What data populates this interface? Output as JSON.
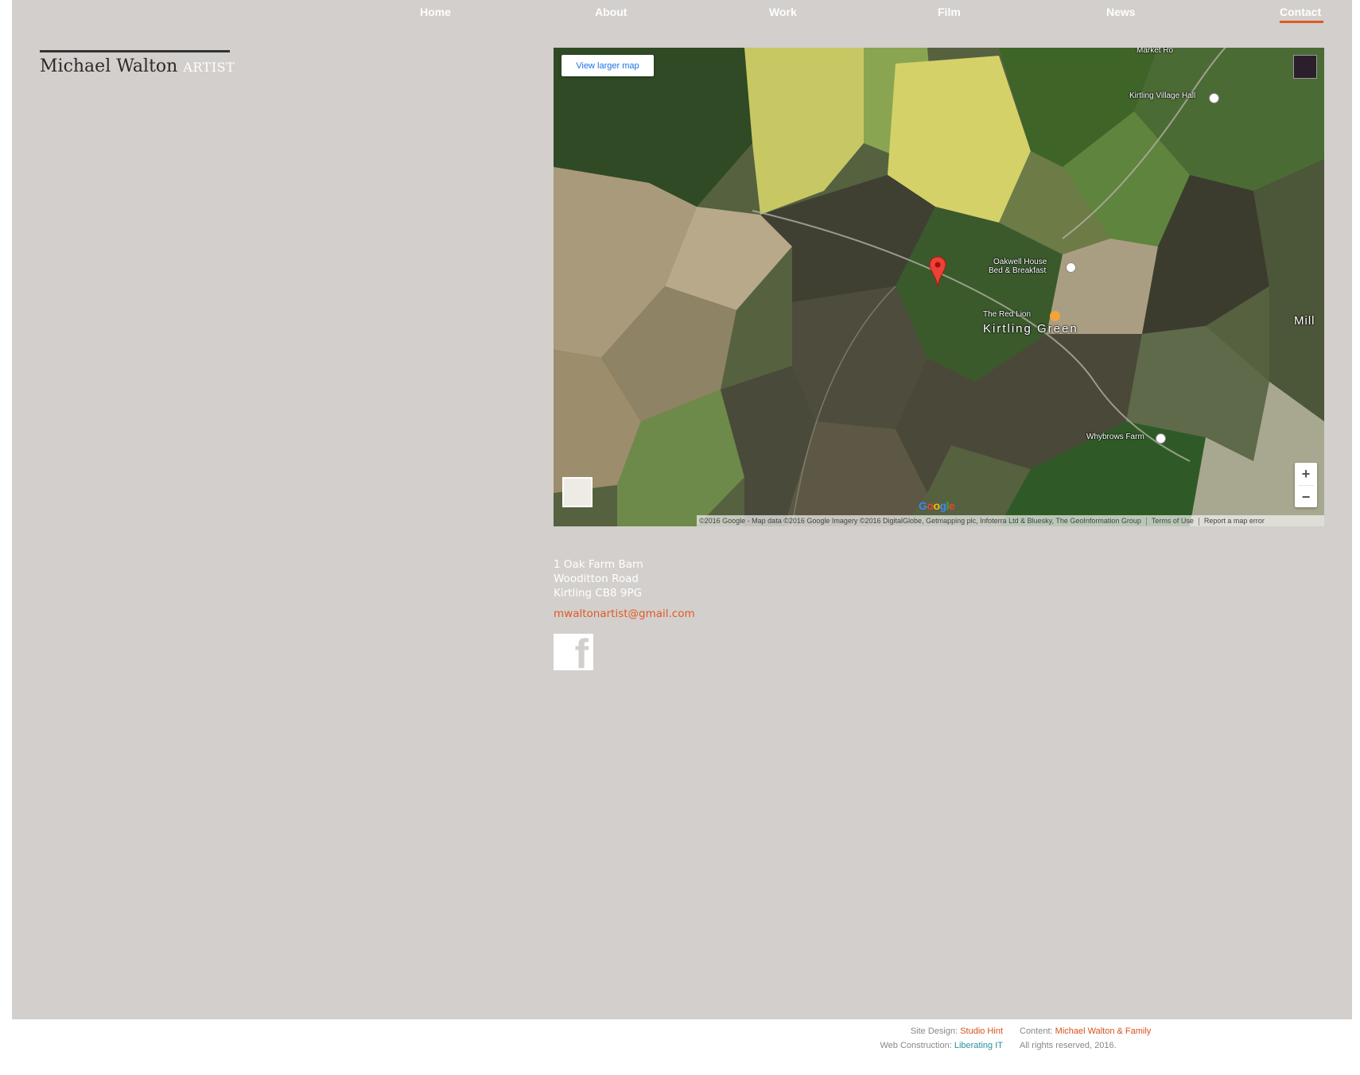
{
  "nav": {
    "items": [
      {
        "label": "Home"
      },
      {
        "label": "About"
      },
      {
        "label": "Work"
      },
      {
        "label": "Film"
      },
      {
        "label": "News"
      },
      {
        "label": "Contact",
        "active": true
      }
    ],
    "accent": "#e05a24"
  },
  "logo": {
    "name": "Michael Walton",
    "tag": "ARTIST"
  },
  "map": {
    "view_larger": "View larger map",
    "labels": {
      "village_hall": "Kirtling Village Hall",
      "oakwell_1": "Oakwell House",
      "oakwell_2": "Bed & Breakfast",
      "red_lion": "The Red Lion",
      "kirtling_green": "Kirtling Green",
      "whybrows": "Whybrows Farm",
      "mill": "Mill",
      "market": "Market Ro"
    },
    "zoom_in": "+",
    "zoom_out": "−",
    "google": "Google",
    "attribution": "©2016 Google - Map data ©2016 Google Imagery ©2016 DigitalGlobe, Getmapping plc, Infoterra Ltd & Bluesky, The GeoInformation Group",
    "terms": "Terms of Use",
    "report": "Report a map error"
  },
  "address": {
    "line1": "1 Oak Farm Barn",
    "line2": "Wooditton Road",
    "line3": "Kirtling CB8 9PG"
  },
  "email": "mwaltonartist@gmail.com",
  "facebook_icon": "f",
  "footer": {
    "design_label": "Site Design:",
    "design_value": "Studio Hint",
    "construction_label": "Web Construction:",
    "construction_value": "Liberating IT",
    "content_label": "Content:",
    "content_value": "Michael Walton & Family",
    "rights": "All rights reserved, 2016."
  }
}
